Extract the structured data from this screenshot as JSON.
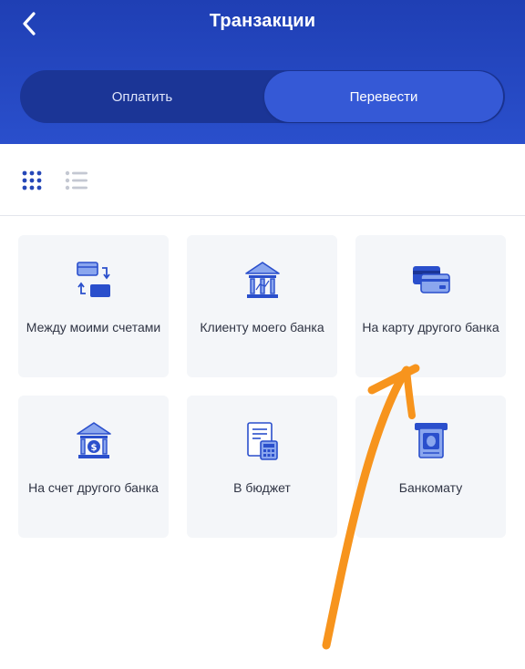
{
  "header": {
    "title": "Транзакции",
    "back_icon": "chevron-left-icon",
    "tabs": [
      {
        "label": "Оплатить",
        "selected": false
      },
      {
        "label": "Перевести",
        "selected": true
      }
    ]
  },
  "view_toggle": {
    "options": [
      "grid",
      "list"
    ],
    "selected": "grid"
  },
  "tiles": [
    {
      "label": "Между моими счетами",
      "icon": "transfer-between-accounts-icon"
    },
    {
      "label": "Клиенту моего банка",
      "icon": "bank-building-icon"
    },
    {
      "label": "На карту другого банка",
      "icon": "bank-cards-icon"
    },
    {
      "label": "На счет другого банка",
      "icon": "bank-dollar-icon"
    },
    {
      "label": "В бюджет",
      "icon": "budget-calculator-icon"
    },
    {
      "label": "Банкомату",
      "icon": "atm-icon"
    }
  ],
  "colors": {
    "header_bg": "#2a4fcc",
    "segment_bg": "#1b3596",
    "segment_selected": "#3559d6",
    "tile_bg": "#f4f6f9",
    "icon_blue": "#2a4fcc",
    "annotation_orange": "#f7941d"
  }
}
